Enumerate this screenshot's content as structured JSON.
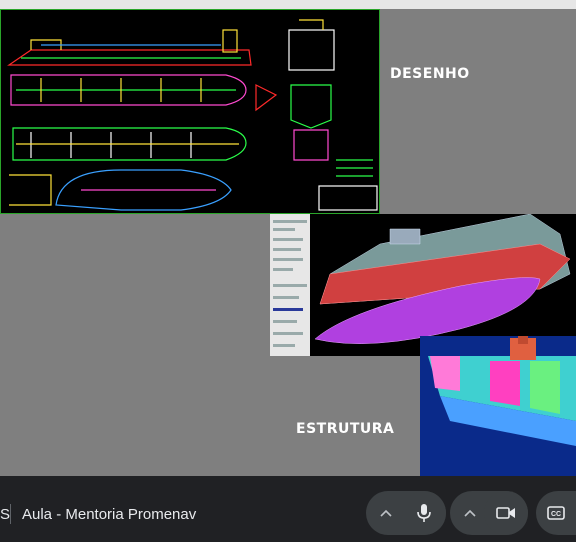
{
  "slide": {
    "label_drawing": "DESENHO",
    "label_structure": "ESTRUTURA"
  },
  "meeting": {
    "title": "Aula - Mentoria Promenav",
    "leading_fragment": "S"
  },
  "controls": {
    "icons": [
      "chevron-up-icon",
      "microphone-icon",
      "chevron-up-icon",
      "camera-icon",
      "captions-icon"
    ],
    "captions_label": "CC"
  }
}
